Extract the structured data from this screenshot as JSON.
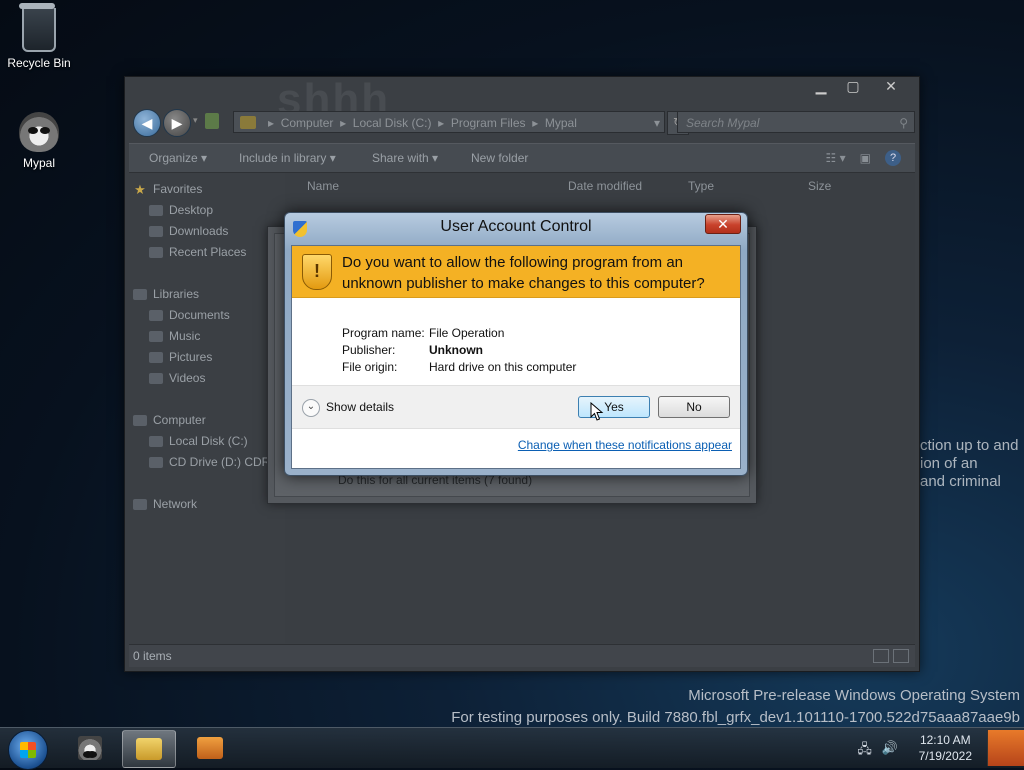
{
  "desktop": {
    "icons": [
      {
        "label": "Recycle Bin",
        "icon": "recycle-bin-icon"
      },
      {
        "label": "Mypal",
        "icon": "mypal-raccoon-icon"
      }
    ],
    "background_text": [
      "ction up to and",
      "ion of an",
      "and criminal"
    ],
    "watermark": {
      "line1": "Microsoft Pre-release Windows Operating System",
      "line2": "For testing purposes only. Build 7880.fbl_grfx_dev1.101110-1700.522d75aaa87aae9b"
    }
  },
  "explorer": {
    "ghost_title": "shhh",
    "address": {
      "crumbs": [
        "Computer",
        "Local Disk (C:)",
        "Program Files",
        "Mypal"
      ]
    },
    "search_placeholder": "Search Mypal",
    "toolbar": {
      "organize": "Organize",
      "include": "Include in library",
      "share": "Share with",
      "new_folder": "New folder"
    },
    "columns": [
      "Name",
      "Date modified",
      "Type",
      "Size"
    ],
    "nav": {
      "favorites": "Favorites",
      "desktop": "Desktop",
      "downloads": "Downloads",
      "recent": "Recent Places",
      "libraries": "Libraries",
      "documents": "Documents",
      "music": "Music",
      "pictures": "Pictures",
      "videos": "Videos",
      "computer": "Computer",
      "local_disk": "Local Disk (C:)",
      "cd_drive": "CD Drive (D:) CDR",
      "network": "Network"
    },
    "status": "0 items"
  },
  "fileop": {
    "text": "Do this for all current items (7 found)"
  },
  "uac": {
    "title": "User Account Control",
    "question": "Do you want to allow the following program from an unknown publisher to make changes to this computer?",
    "program_name_label": "Program name:",
    "program_name": "File Operation",
    "publisher_label": "Publisher:",
    "publisher": "Unknown",
    "origin_label": "File origin:",
    "origin": "Hard drive on this computer",
    "show_details": "Show details",
    "yes": "Yes",
    "no": "No",
    "link": "Change when these notifications appear"
  },
  "taskbar": {
    "time": "12:10 AM",
    "date": "7/19/2022"
  },
  "colors": {
    "uac_banner": "#f4b124",
    "link": "#0b5fb3",
    "close_red": "#c8412b"
  }
}
